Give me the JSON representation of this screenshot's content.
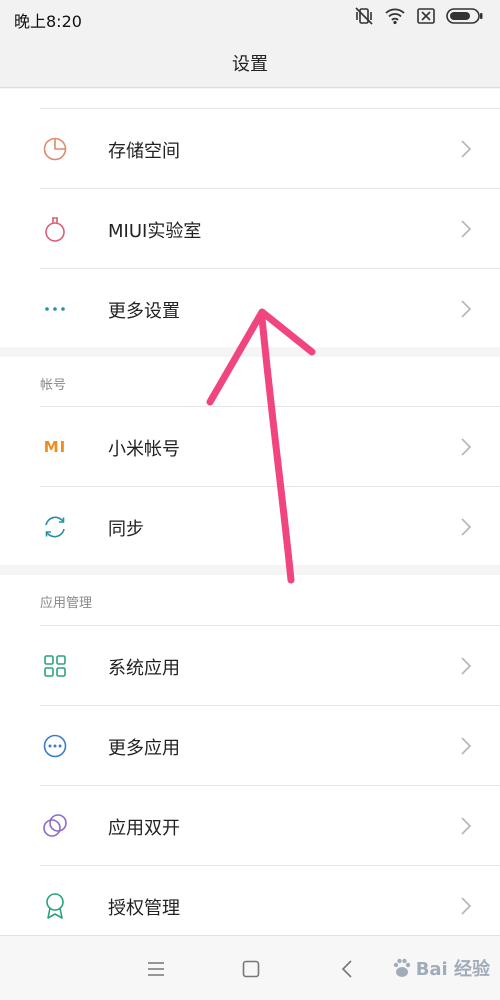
{
  "status_bar": {
    "time": "晚上8:20",
    "icons": [
      "vibrate-off-icon",
      "wifi-icon",
      "sim-off-icon",
      "battery-icon"
    ]
  },
  "header": {
    "title": "设置"
  },
  "sections": {
    "top": {
      "items": [
        {
          "label": "存储空间",
          "icon": "storage-pie-icon",
          "color": "#e0896b"
        },
        {
          "label": "MIUI实验室",
          "icon": "flask-icon",
          "color": "#d9607a"
        },
        {
          "label": "更多设置",
          "icon": "more-dots-icon",
          "color": "#2a8fa8"
        }
      ]
    },
    "account": {
      "header": "帐号",
      "items": [
        {
          "label": "小米帐号",
          "icon": "mi-logo-icon",
          "color": "#f08c1a"
        },
        {
          "label": "同步",
          "icon": "sync-icon",
          "color": "#2a8fa8"
        }
      ]
    },
    "apps": {
      "header": "应用管理",
      "items": [
        {
          "label": "系统应用",
          "icon": "grid-icon",
          "color": "#2aa37a"
        },
        {
          "label": "更多应用",
          "icon": "more-circle-icon",
          "color": "#3a7dc9"
        },
        {
          "label": "应用双开",
          "icon": "dual-app-icon",
          "color": "#8a6ad0"
        },
        {
          "label": "授权管理",
          "icon": "badge-icon",
          "color": "#2aa37a"
        }
      ]
    }
  },
  "icon_logos": {
    "mi_logo": "MI"
  },
  "nav_bar": {
    "buttons": [
      "menu-icon",
      "home-icon",
      "back-icon"
    ]
  },
  "watermark": {
    "text": "Bai 经验"
  },
  "annotation": {
    "color": "#f0457f"
  }
}
